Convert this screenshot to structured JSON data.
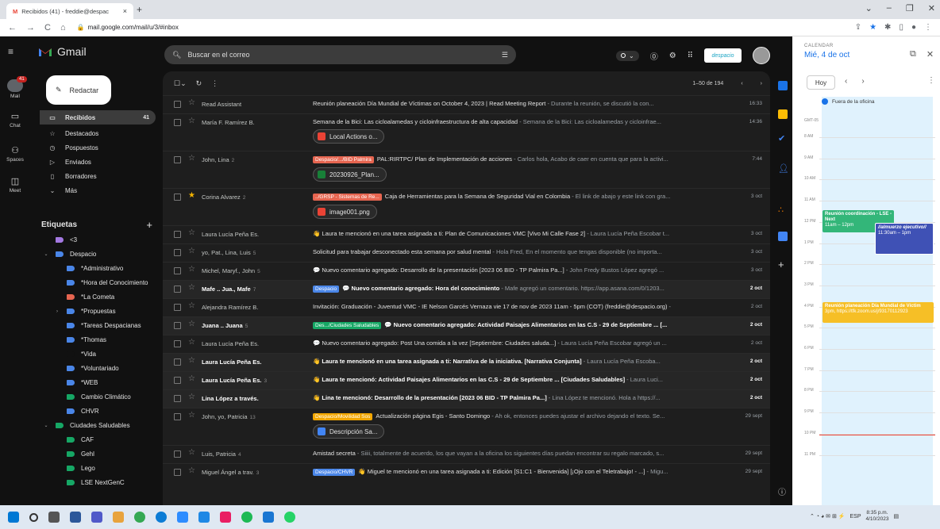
{
  "browser": {
    "tab_title": "Recibidos (41) - freddie@despac",
    "url": "mail.google.com/mail/u/3/#inbox"
  },
  "gmail": {
    "logo": "Gmail",
    "search_placeholder": "Buscar en el correo",
    "compose": "Redactar",
    "pager": "1–50 de 194",
    "account": "despacio"
  },
  "rail": [
    {
      "label": "Mail",
      "badge": "41"
    },
    {
      "label": "Chat"
    },
    {
      "label": "Spaces"
    },
    {
      "label": "Meet"
    }
  ],
  "nav": [
    {
      "label": "Recibidos",
      "count": "41"
    },
    {
      "label": "Destacados"
    },
    {
      "label": "Pospuestos"
    },
    {
      "label": "Enviados"
    },
    {
      "label": "Borradores"
    },
    {
      "label": "Más"
    }
  ],
  "labels_title": "Etiquetas",
  "labels": [
    {
      "name": "<3",
      "color": "#a479e2"
    },
    {
      "name": "Despacio",
      "color": "#4a86e8"
    },
    {
      "name": "*Administrativo",
      "color": "#4a86e8"
    },
    {
      "name": "*Hora del Conocimiento",
      "color": "#4a86e8"
    },
    {
      "name": "*La Cometa",
      "color": "#e66550"
    },
    {
      "name": "*Propuestas",
      "color": "#4a86e8"
    },
    {
      "name": "*Tareas Despacianas",
      "color": "#4a86e8"
    },
    {
      "name": "*Thomas",
      "color": "#4a86e8"
    },
    {
      "name": "*Vida",
      "color": "#111111"
    },
    {
      "name": "*Voluntariado",
      "color": "#4a86e8"
    },
    {
      "name": "*WEB",
      "color": "#4a86e8"
    },
    {
      "name": "Cambio Climático",
      "color": "#16a765"
    },
    {
      "name": "CHVR",
      "color": "#4a86e8"
    },
    {
      "name": "Ciudades Saludables",
      "color": "#16a765"
    },
    {
      "name": "CAF",
      "color": "#16a765"
    },
    {
      "name": "Gehl",
      "color": "#16a765"
    },
    {
      "name": "Lego",
      "color": "#16a765"
    },
    {
      "name": "LSE NextGenC",
      "color": "#16a765"
    }
  ],
  "emails": [
    {
      "sender": "Read Assistant",
      "subject": "Reunión planeación Día Mundial de Víctimas on October 4, 2023 | Read Meeting Report",
      "snippet": " - Durante la reunión, se discutió la con...",
      "date": "16:33",
      "unread": false,
      "starred": false
    },
    {
      "sender": "María F. Ramírez B.",
      "subject": "Semana de la Bici: Las cicloalamedas y cicloinfraestructura de alta capacidad",
      "snippet": " - Semana de la Bici: Las cicloalamedas y cicloinfrae...",
      "date": "14:36",
      "attachment": "Local Actions o...",
      "unread": false,
      "starred": false
    },
    {
      "sender": "John, Lina",
      "count": "2",
      "chip": "Despacio/.../BID Palmira",
      "subject": "PAL:RIRTPC/ Plan de Implementación de acciones",
      "snippet": " - Carlos hola, Acabo de caer en cuenta que para la activi...",
      "date": "7:44",
      "attachment": "20230926_Plan...",
      "unread": false,
      "starred": false
    },
    {
      "sender": "Corina Alvarez",
      "count": "2",
      "chip": "../GRSP - Sistemas de Re...",
      "subject": "Caja de Herramientas para la Semana de Seguridad Vial en Colombia",
      "snippet": " - El link de abajo y este link con gra...",
      "date": "3 oct",
      "attachment": "image001.png",
      "unread": false,
      "starred": true
    },
    {
      "sender": "Laura Lucía Peña Es.",
      "subject": "👋 Laura te mencionó en una tarea asignada a ti: Plan de Comunicaciones VMC [Vivo Mi Calle Fase 2]",
      "snippet": " - Laura Lucía Peña Escobar t...",
      "date": "3 oct",
      "unread": false,
      "starred": false
    },
    {
      "sender": "yo, Pat., Lina, Luis",
      "count": "5",
      "subject": "Solicitud para trabajar desconectado esta semana por salud mental",
      "snippet": " - Hola Fred, En el momento que tengas disponible (no importa...",
      "date": "3 oct",
      "unread": false,
      "starred": false
    },
    {
      "sender": "Michel, Maryf., John",
      "count": "5",
      "subject": "💬 Nuevo comentario agregado: Desarrollo de la presentación [2023 06 BID - TP Palmira Pa...]",
      "snippet": " - John Fredy Bustos López agregó ...",
      "date": "3 oct",
      "unread": false,
      "starred": false
    },
    {
      "sender": "Mafe .. Jua., Mafe",
      "count": "7",
      "chip": "Despacio",
      "subject": "💬 Nuevo comentario agregado: Hora del conocimiento",
      "snippet": " - Mafe agregó un comentario. https://app.asana.com/0/1203...",
      "date": "2 oct",
      "unread": true,
      "starred": false
    },
    {
      "sender": "Alejandra Ramírez B.",
      "subject": "Invitación: Graduación - Juventud VMC - IE Nelson Garcés Vernaza vie 17 de nov de 2023 11am - 5pm (COT) (freddie@despacio.org)",
      "snippet": " -",
      "date": "2 oct",
      "unread": false,
      "starred": false
    },
    {
      "sender": "Juana .. Juana",
      "count": "5",
      "chip": "Des.../Ciudades Saludables",
      "subject": "💬 Nuevo comentario agregado: Actividad Paisajes Alimentarios en las C.S - 29 de Septiembre ... [...",
      "snippet": "",
      "date": "2 oct",
      "unread": true,
      "starred": false
    },
    {
      "sender": "Laura Lucía Peña Es.",
      "subject": "💬 Nuevo comentario agregado: Post Una comida a la vez [Septiembre: Ciudades saluda...]",
      "snippet": " - Laura Lucía Peña Escobar agregó un ...",
      "date": "2 oct",
      "unread": false,
      "starred": false
    },
    {
      "sender": "Laura Lucía Peña Es.",
      "subject": "👋 Laura te mencionó en una tarea asignada a ti: Narrativa de la iniciativa. [Narrativa Conjunta]",
      "snippet": " - Laura Lucía Peña Escoba...",
      "date": "2 oct",
      "unread": true,
      "starred": false
    },
    {
      "sender": "Laura Lucía Peña Es.",
      "count": "3",
      "subject": "👋 Laura te mencionó: Actividad Paisajes Alimentarios en las C.S - 29 de Septiembre ... [Ciudades Saludables]",
      "snippet": " - Laura Luci...",
      "date": "2 oct",
      "unread": true,
      "starred": false
    },
    {
      "sender": "Lina López a través.",
      "subject": "👋 Lina te mencionó: Desarrollo de la presentación [2023 06 BID - TP Palmira Pa...]",
      "snippet": " - Lina López te mencionó. Hola a https://...",
      "date": "2 oct",
      "unread": true,
      "starred": false
    },
    {
      "sender": "John, yo, Patricia",
      "count": "13",
      "chip": "Despacio/Movilidad Sos",
      "subject": "Actualización página Egis - Santo Domingo",
      "snippet": " - Ah ok, entonces puedes ajustar el archivo dejando el texto. Se...",
      "date": "29 sept",
      "attachment": "Descripción Sa...",
      "unread": false,
      "starred": false
    },
    {
      "sender": "Luis, Patricia",
      "count": "4",
      "subject": "Amistad secreta",
      "snippet": " - Siiii, totalmente de acuerdo, los que vayan a la oficina los siguientes días puedan encontrar su regalo marcado, s...",
      "date": "29 sept",
      "unread": false,
      "starred": false
    },
    {
      "sender": "Miguel Ángel a trav.",
      "count": "3",
      "chip": "Despacio/CHVR",
      "subject": "👋 Miguel te mencionó en una tarea asignada a ti: Edición [S1:C1 - Bienvenida] [¡Ojo con el Teletrabajo! - ...]",
      "snippet": " - Migu...",
      "date": "29 sept",
      "unread": false,
      "starred": false
    }
  ],
  "calendar": {
    "header": "CALENDAR",
    "date": "Mié, 4 de oct",
    "today": "Hoy",
    "allday": "Fuera de la oficina",
    "gmt": "GMT-05",
    "hours": [
      "8 AM",
      "9 AM",
      "10 AM",
      "11 AM",
      "12 PM",
      "1 PM",
      "2 PM",
      "3 PM",
      "4 PM",
      "5 PM",
      "6 PM",
      "7 PM",
      "8 PM",
      "9 PM",
      "10 PM",
      "11 PM"
    ],
    "events": [
      {
        "title": "Reunión coordinación - LSE - Next",
        "time": "11am – 12pm",
        "color": "#33b679"
      },
      {
        "title": "//almuerzo ejecutivo//",
        "time": "11:30am – 1pm",
        "color": "#3f51b5"
      },
      {
        "title": "Reunión planeación Día Mundial de Víctim",
        "time": "3pm, https://tfk.zoom.us/j/93170112923",
        "color": "#f6bf26"
      }
    ]
  },
  "taskbar": {
    "time": "8:35 p.m.",
    "date": "4/10/2023",
    "lang": "ESP"
  }
}
